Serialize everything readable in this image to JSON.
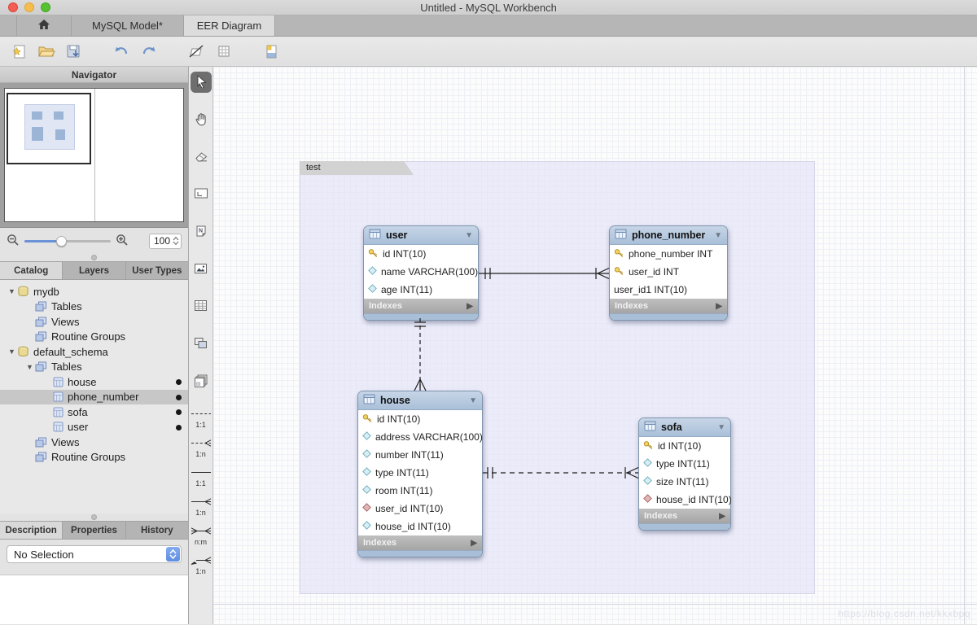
{
  "window": {
    "title": "Untitled - MySQL Workbench"
  },
  "tabs": {
    "home": "home",
    "model": "MySQL Model*",
    "eer": "EER Diagram",
    "active": "EER Diagram"
  },
  "toolbar": {
    "icons": [
      "new-model",
      "open-model",
      "save-model",
      "undo",
      "redo",
      "toggle-pen",
      "toggle-grid",
      "new-page"
    ]
  },
  "navigator": {
    "title": "Navigator",
    "zoom_value": "100"
  },
  "catalog": {
    "tabs": [
      "Catalog",
      "Layers",
      "User Types"
    ],
    "tree": [
      {
        "label": "mydb",
        "icon": "schema",
        "level": 0,
        "expanded": true,
        "dot": false,
        "selected": false
      },
      {
        "label": "Tables",
        "icon": "group",
        "level": 1,
        "expanded": false,
        "dot": false,
        "selected": false
      },
      {
        "label": "Views",
        "icon": "group",
        "level": 1,
        "expanded": false,
        "dot": false,
        "selected": false
      },
      {
        "label": "Routine Groups",
        "icon": "group",
        "level": 1,
        "expanded": false,
        "dot": false,
        "selected": false
      },
      {
        "label": "default_schema",
        "icon": "schema",
        "level": 0,
        "expanded": true,
        "dot": false,
        "selected": false
      },
      {
        "label": "Tables",
        "icon": "group",
        "level": 1,
        "expanded": true,
        "dot": false,
        "selected": false
      },
      {
        "label": "house",
        "icon": "table",
        "level": 2,
        "expanded": false,
        "dot": true,
        "selected": false
      },
      {
        "label": "phone_number",
        "icon": "table",
        "level": 2,
        "expanded": false,
        "dot": true,
        "selected": true
      },
      {
        "label": "sofa",
        "icon": "table",
        "level": 2,
        "expanded": false,
        "dot": true,
        "selected": false
      },
      {
        "label": "user",
        "icon": "table",
        "level": 2,
        "expanded": false,
        "dot": true,
        "selected": false
      },
      {
        "label": "Views",
        "icon": "group",
        "level": 1,
        "expanded": false,
        "dot": false,
        "selected": false
      },
      {
        "label": "Routine Groups",
        "icon": "group",
        "level": 1,
        "expanded": false,
        "dot": false,
        "selected": false
      }
    ]
  },
  "inspector": {
    "tabs": [
      "Description",
      "Properties",
      "History"
    ],
    "selection": "No Selection"
  },
  "palette": {
    "tools": [
      "pointer",
      "hand",
      "eraser",
      "layer",
      "note",
      "image",
      "table",
      "view",
      "routine-group"
    ],
    "rel_tools": [
      {
        "label": "1:1",
        "style": "dashed",
        "foot": false
      },
      {
        "label": "1:n",
        "style": "dashed",
        "foot": true
      },
      {
        "label": "1:1",
        "style": "solid",
        "foot": false
      },
      {
        "label": "1:n",
        "style": "solid",
        "foot": true
      },
      {
        "label": "n:m",
        "style": "solid",
        "foot": true
      },
      {
        "label": "1:n",
        "style": "pen",
        "foot": true
      }
    ]
  },
  "diagram": {
    "layer_label": "test",
    "tables": [
      {
        "name": "user",
        "footer": "Indexes",
        "columns": [
          {
            "text": "id INT(10)",
            "icon": "key"
          },
          {
            "text": "name VARCHAR(100)",
            "icon": "col"
          },
          {
            "text": "age INT(11)",
            "icon": "col"
          }
        ]
      },
      {
        "name": "phone_number",
        "footer": "Indexes",
        "columns": [
          {
            "text": "phone_number INT",
            "icon": "key"
          },
          {
            "text": "user_id INT",
            "icon": "key"
          },
          {
            "text": "user_id1 INT(10)",
            "icon": "plain"
          }
        ]
      },
      {
        "name": "house",
        "footer": "Indexes",
        "columns": [
          {
            "text": "id INT(10)",
            "icon": "key"
          },
          {
            "text": "address VARCHAR(100)",
            "icon": "col"
          },
          {
            "text": "number INT(11)",
            "icon": "col"
          },
          {
            "text": "type INT(11)",
            "icon": "col"
          },
          {
            "text": "room INT(11)",
            "icon": "col"
          },
          {
            "text": "user_id INT(10)",
            "icon": "fk"
          },
          {
            "text": "house_id INT(10)",
            "icon": "col"
          }
        ]
      },
      {
        "name": "sofa",
        "footer": "Indexes",
        "columns": [
          {
            "text": "id INT(10)",
            "icon": "key"
          },
          {
            "text": "type INT(11)",
            "icon": "col"
          },
          {
            "text": "size INT(11)",
            "icon": "col"
          },
          {
            "text": "house_id INT(10)",
            "icon": "fk"
          }
        ]
      }
    ],
    "relationships": [
      {
        "from": "user",
        "to": "phone_number",
        "line": "solid",
        "cardinality": "1:n"
      },
      {
        "from": "user",
        "to": "house",
        "line": "dashed",
        "cardinality": "1:n"
      },
      {
        "from": "house",
        "to": "sofa",
        "line": "dashed",
        "cardinality": "1:n"
      }
    ]
  },
  "colors": {
    "table_header": "#aebfd8",
    "layer_bg": "#e6e6f6",
    "indexes_bar": "#adadad",
    "accent_blue": "#6b92d6"
  },
  "watermark": "https://blog.csdn.net/kkxbpq"
}
